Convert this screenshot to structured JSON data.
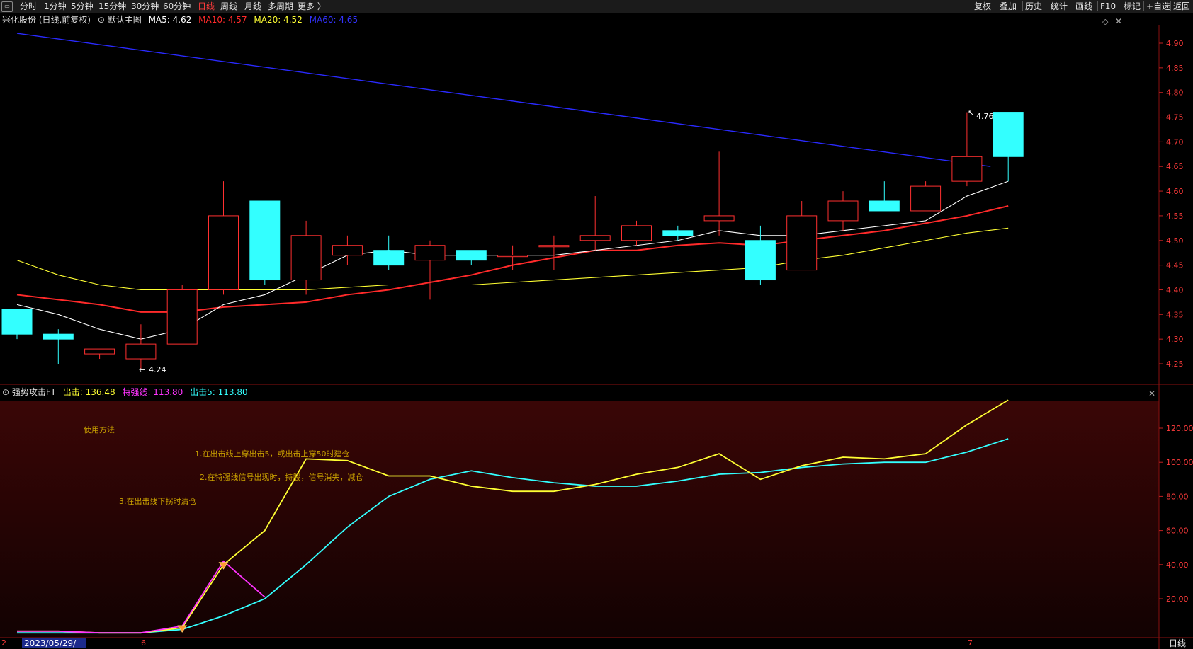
{
  "toolbar": {
    "periods": [
      "分时",
      "1分钟",
      "5分钟",
      "15分钟",
      "30分钟",
      "60分钟",
      "日线",
      "周线",
      "月线",
      "多周期",
      "更多 〉"
    ],
    "active_period": "日线",
    "right_buttons": [
      "复权",
      "叠加",
      "历史",
      "统计",
      "画线",
      "F10",
      "标记",
      "+自选",
      "返回"
    ]
  },
  "main_info": {
    "stock": "兴化股份 (日线,前复权)",
    "chart_name": "默认主图",
    "ma5": "MA5: 4.62",
    "ma10": "MA10: 4.57",
    "ma20": "MA20: 4.52",
    "ma60": "MA60: 4.65",
    "colors": {
      "ma5": "#ffffff",
      "ma10": "#ff2a2a",
      "ma20": "#ffff33",
      "ma60": "#2a2aff"
    }
  },
  "price_axis": {
    "ticks": [
      "4.90",
      "4.85",
      "4.80",
      "4.75",
      "4.70",
      "4.65",
      "4.60",
      "4.55",
      "4.50",
      "4.45",
      "4.40",
      "4.35",
      "4.30",
      "4.25"
    ],
    "min": 4.2,
    "max": 4.95
  },
  "price_annotations": {
    "high": "4.76",
    "low": "4.24"
  },
  "indicator_info": {
    "name": "强势攻击FT",
    "chuji": "出击: 136.48",
    "teqiang": "特强线: 113.80",
    "chuji5": "出击5: 113.80",
    "colors": {
      "chuji": "#ffff33",
      "teqiang": "#ff33ff",
      "chuji5": "#33ffff"
    }
  },
  "indicator_axis": {
    "ticks": [
      "120.00",
      "100.00",
      "80.00",
      "60.00",
      "40.00",
      "20.00"
    ],
    "min": 0,
    "max": 140
  },
  "notes": {
    "title": "使用方法",
    "line1": "1.在出击线上穿出击5，或出击上穿50时建仓",
    "line2": "2.在特强线信号出现时，持股，信号消失，减仓",
    "line3": "3.在出击线下拐时清仓"
  },
  "bottom": {
    "date": "2023/05/29/一",
    "marks": [
      "2",
      "6",
      "7"
    ],
    "period_label": "日线"
  },
  "chart_data": {
    "type": "candlestick",
    "candles": [
      {
        "o": 4.36,
        "c": 4.31,
        "h": 4.36,
        "l": 4.3
      },
      {
        "o": 4.31,
        "c": 4.3,
        "h": 4.32,
        "l": 4.25
      },
      {
        "o": 4.27,
        "c": 4.28,
        "h": 4.28,
        "l": 4.26
      },
      {
        "o": 4.26,
        "c": 4.29,
        "h": 4.33,
        "l": 4.24
      },
      {
        "o": 4.29,
        "c": 4.4,
        "h": 4.41,
        "l": 4.29
      },
      {
        "o": 4.4,
        "c": 4.55,
        "h": 4.62,
        "l": 4.39
      },
      {
        "o": 4.58,
        "c": 4.42,
        "h": 4.58,
        "l": 4.41
      },
      {
        "o": 4.42,
        "c": 4.51,
        "h": 4.54,
        "l": 4.39
      },
      {
        "o": 4.47,
        "c": 4.49,
        "h": 4.51,
        "l": 4.45
      },
      {
        "o": 4.48,
        "c": 4.45,
        "h": 4.51,
        "l": 4.44
      },
      {
        "o": 4.46,
        "c": 4.49,
        "h": 4.5,
        "l": 4.38
      },
      {
        "o": 4.48,
        "c": 4.46,
        "h": 4.48,
        "l": 4.45
      },
      {
        "o": 4.47,
        "c": 4.47,
        "h": 4.49,
        "l": 4.44
      },
      {
        "o": 4.49,
        "c": 4.49,
        "h": 4.51,
        "l": 4.44
      },
      {
        "o": 4.5,
        "c": 4.51,
        "h": 4.59,
        "l": 4.48
      },
      {
        "o": 4.5,
        "c": 4.53,
        "h": 4.54,
        "l": 4.49
      },
      {
        "o": 4.52,
        "c": 4.51,
        "h": 4.53,
        "l": 4.5
      },
      {
        "o": 4.54,
        "c": 4.55,
        "h": 4.68,
        "l": 4.51
      },
      {
        "o": 4.5,
        "c": 4.42,
        "h": 4.53,
        "l": 4.41
      },
      {
        "o": 4.44,
        "c": 4.55,
        "h": 4.58,
        "l": 4.44
      },
      {
        "o": 4.54,
        "c": 4.58,
        "h": 4.6,
        "l": 4.52
      },
      {
        "o": 4.58,
        "c": 4.56,
        "h": 4.62,
        "l": 4.56
      },
      {
        "o": 4.56,
        "c": 4.61,
        "h": 4.62,
        "l": 4.56
      },
      {
        "o": 4.62,
        "c": 4.67,
        "h": 4.76,
        "l": 4.61
      },
      {
        "o": 4.76,
        "c": 4.67,
        "h": 4.76,
        "l": 4.62
      }
    ],
    "ma5": [
      4.37,
      4.35,
      4.32,
      4.3,
      4.32,
      4.37,
      4.39,
      4.43,
      4.47,
      4.48,
      4.47,
      4.47,
      4.47,
      4.47,
      4.48,
      4.49,
      4.5,
      4.52,
      4.51,
      4.51,
      4.52,
      4.53,
      4.54,
      4.59,
      4.62
    ],
    "ma10": [
      4.39,
      4.38,
      4.37,
      4.355,
      4.355,
      4.365,
      4.37,
      4.375,
      4.39,
      4.4,
      4.415,
      4.43,
      4.45,
      4.465,
      4.48,
      4.48,
      4.49,
      4.495,
      4.49,
      4.5,
      4.51,
      4.52,
      4.535,
      4.55,
      4.57
    ],
    "ma20": [
      4.46,
      4.43,
      4.41,
      4.4,
      4.4,
      4.4,
      4.4,
      4.4,
      4.405,
      4.41,
      4.41,
      4.41,
      4.415,
      4.42,
      4.425,
      4.43,
      4.435,
      4.44,
      4.445,
      4.46,
      4.47,
      4.485,
      4.5,
      4.515,
      4.525
    ],
    "ma60_start": 4.92,
    "ma60_end": 4.65,
    "chuji": [
      1,
      1,
      0,
      0,
      3,
      40,
      60,
      102,
      101,
      92,
      92,
      86,
      83,
      83,
      87,
      93,
      97,
      105,
      90,
      98,
      103,
      102,
      105,
      122,
      136.48
    ],
    "chuji5": [
      0,
      0,
      0,
      0,
      2,
      10,
      20,
      40,
      62,
      80,
      90,
      95,
      91,
      88,
      86,
      86,
      89,
      93,
      94,
      97,
      99,
      100,
      100,
      106,
      113.8
    ],
    "teqiang": [
      1,
      1,
      0,
      0,
      4,
      42,
      21,
      null,
      null,
      null,
      null,
      null,
      null,
      null,
      null,
      null,
      null,
      null,
      null,
      null,
      null,
      null,
      null,
      null,
      null
    ]
  }
}
